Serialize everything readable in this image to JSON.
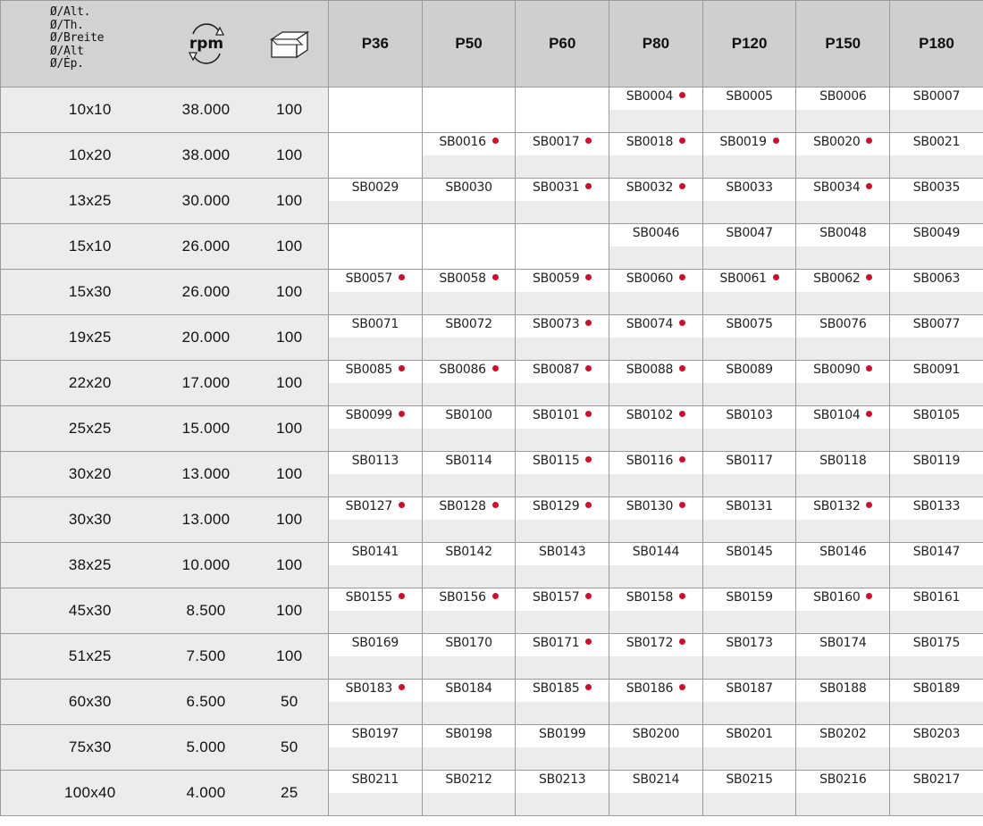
{
  "header": {
    "dimension_labels": [
      "Ø/Alt.",
      "Ø/Th.",
      "Ø/Breite",
      "Ø/Alt",
      "Ø/Ép."
    ],
    "rpm_icon_text": "rpm",
    "grits": [
      "P36",
      "P50",
      "P60",
      "P80",
      "P120",
      "P150",
      "P180"
    ]
  },
  "accent_color": "#c8102e",
  "rows": [
    {
      "size": "10x10",
      "rpm": "38.000",
      "qty": "100",
      "cells": [
        {
          "code": "",
          "dot": false
        },
        {
          "code": "",
          "dot": false
        },
        {
          "code": "",
          "dot": false
        },
        {
          "code": "SB0004",
          "dot": true
        },
        {
          "code": "SB0005",
          "dot": false
        },
        {
          "code": "SB0006",
          "dot": false
        },
        {
          "code": "SB0007",
          "dot": false
        }
      ]
    },
    {
      "size": "10x20",
      "rpm": "38.000",
      "qty": "100",
      "cells": [
        {
          "code": "",
          "dot": false
        },
        {
          "code": "SB0016",
          "dot": true
        },
        {
          "code": "SB0017",
          "dot": true
        },
        {
          "code": "SB0018",
          "dot": true
        },
        {
          "code": "SB0019",
          "dot": true
        },
        {
          "code": "SB0020",
          "dot": true
        },
        {
          "code": "SB0021",
          "dot": false
        }
      ]
    },
    {
      "size": "13x25",
      "rpm": "30.000",
      "qty": "100",
      "cells": [
        {
          "code": "SB0029",
          "dot": false
        },
        {
          "code": "SB0030",
          "dot": false
        },
        {
          "code": "SB0031",
          "dot": true
        },
        {
          "code": "SB0032",
          "dot": true
        },
        {
          "code": "SB0033",
          "dot": false
        },
        {
          "code": "SB0034",
          "dot": true
        },
        {
          "code": "SB0035",
          "dot": false
        }
      ]
    },
    {
      "size": "15x10",
      "rpm": "26.000",
      "qty": "100",
      "cells": [
        {
          "code": "",
          "dot": false
        },
        {
          "code": "",
          "dot": false
        },
        {
          "code": "",
          "dot": false
        },
        {
          "code": "SB0046",
          "dot": false
        },
        {
          "code": "SB0047",
          "dot": false
        },
        {
          "code": "SB0048",
          "dot": false
        },
        {
          "code": "SB0049",
          "dot": false
        }
      ]
    },
    {
      "size": "15x30",
      "rpm": "26.000",
      "qty": "100",
      "cells": [
        {
          "code": "SB0057",
          "dot": true
        },
        {
          "code": "SB0058",
          "dot": true
        },
        {
          "code": "SB0059",
          "dot": true
        },
        {
          "code": "SB0060",
          "dot": true
        },
        {
          "code": "SB0061",
          "dot": true
        },
        {
          "code": "SB0062",
          "dot": true
        },
        {
          "code": "SB0063",
          "dot": false
        }
      ]
    },
    {
      "size": "19x25",
      "rpm": "20.000",
      "qty": "100",
      "cells": [
        {
          "code": "SB0071",
          "dot": false
        },
        {
          "code": "SB0072",
          "dot": false
        },
        {
          "code": "SB0073",
          "dot": true
        },
        {
          "code": "SB0074",
          "dot": true
        },
        {
          "code": "SB0075",
          "dot": false
        },
        {
          "code": "SB0076",
          "dot": false
        },
        {
          "code": "SB0077",
          "dot": false
        }
      ]
    },
    {
      "size": "22x20",
      "rpm": "17.000",
      "qty": "100",
      "cells": [
        {
          "code": "SB0085",
          "dot": true
        },
        {
          "code": "SB0086",
          "dot": true
        },
        {
          "code": "SB0087",
          "dot": true
        },
        {
          "code": "SB0088",
          "dot": true
        },
        {
          "code": "SB0089",
          "dot": false
        },
        {
          "code": "SB0090",
          "dot": true
        },
        {
          "code": "SB0091",
          "dot": false
        }
      ]
    },
    {
      "size": "25x25",
      "rpm": "15.000",
      "qty": "100",
      "cells": [
        {
          "code": "SB0099",
          "dot": true
        },
        {
          "code": "SB0100",
          "dot": false
        },
        {
          "code": "SB0101",
          "dot": true
        },
        {
          "code": "SB0102",
          "dot": true
        },
        {
          "code": "SB0103",
          "dot": false
        },
        {
          "code": "SB0104",
          "dot": true
        },
        {
          "code": "SB0105",
          "dot": false
        }
      ]
    },
    {
      "size": "30x20",
      "rpm": "13.000",
      "qty": "100",
      "cells": [
        {
          "code": "SB0113",
          "dot": false
        },
        {
          "code": "SB0114",
          "dot": false
        },
        {
          "code": "SB0115",
          "dot": true
        },
        {
          "code": "SB0116",
          "dot": true
        },
        {
          "code": "SB0117",
          "dot": false
        },
        {
          "code": "SB0118",
          "dot": false
        },
        {
          "code": "SB0119",
          "dot": false
        }
      ]
    },
    {
      "size": "30x30",
      "rpm": "13.000",
      "qty": "100",
      "cells": [
        {
          "code": "SB0127",
          "dot": true
        },
        {
          "code": "SB0128",
          "dot": true
        },
        {
          "code": "SB0129",
          "dot": true
        },
        {
          "code": "SB0130",
          "dot": true
        },
        {
          "code": "SB0131",
          "dot": false
        },
        {
          "code": "SB0132",
          "dot": true
        },
        {
          "code": "SB0133",
          "dot": false
        }
      ]
    },
    {
      "size": "38x25",
      "rpm": "10.000",
      "qty": "100",
      "cells": [
        {
          "code": "SB0141",
          "dot": false
        },
        {
          "code": "SB0142",
          "dot": false
        },
        {
          "code": "SB0143",
          "dot": false
        },
        {
          "code": "SB0144",
          "dot": false
        },
        {
          "code": "SB0145",
          "dot": false
        },
        {
          "code": "SB0146",
          "dot": false
        },
        {
          "code": "SB0147",
          "dot": false
        }
      ]
    },
    {
      "size": "45x30",
      "rpm": "8.500",
      "qty": "100",
      "cells": [
        {
          "code": "SB0155",
          "dot": true
        },
        {
          "code": "SB0156",
          "dot": true
        },
        {
          "code": "SB0157",
          "dot": true
        },
        {
          "code": "SB0158",
          "dot": true
        },
        {
          "code": "SB0159",
          "dot": false
        },
        {
          "code": "SB0160",
          "dot": true
        },
        {
          "code": "SB0161",
          "dot": false
        }
      ]
    },
    {
      "size": "51x25",
      "rpm": "7.500",
      "qty": "100",
      "cells": [
        {
          "code": "SB0169",
          "dot": false
        },
        {
          "code": "SB0170",
          "dot": false
        },
        {
          "code": "SB0171",
          "dot": true
        },
        {
          "code": "SB0172",
          "dot": true
        },
        {
          "code": "SB0173",
          "dot": false
        },
        {
          "code": "SB0174",
          "dot": false
        },
        {
          "code": "SB0175",
          "dot": false
        }
      ]
    },
    {
      "size": "60x30",
      "rpm": "6.500",
      "qty": "50",
      "cells": [
        {
          "code": "SB0183",
          "dot": true
        },
        {
          "code": "SB0184",
          "dot": false
        },
        {
          "code": "SB0185",
          "dot": true
        },
        {
          "code": "SB0186",
          "dot": true
        },
        {
          "code": "SB0187",
          "dot": false
        },
        {
          "code": "SB0188",
          "dot": false
        },
        {
          "code": "SB0189",
          "dot": false
        }
      ]
    },
    {
      "size": "75x30",
      "rpm": "5.000",
      "qty": "50",
      "cells": [
        {
          "code": "SB0197",
          "dot": false
        },
        {
          "code": "SB0198",
          "dot": false
        },
        {
          "code": "SB0199",
          "dot": false
        },
        {
          "code": "SB0200",
          "dot": false
        },
        {
          "code": "SB0201",
          "dot": false
        },
        {
          "code": "SB0202",
          "dot": false
        },
        {
          "code": "SB0203",
          "dot": false
        }
      ]
    },
    {
      "size": "100x40",
      "rpm": "4.000",
      "qty": "25",
      "cells": [
        {
          "code": "SB0211",
          "dot": false
        },
        {
          "code": "SB0212",
          "dot": false
        },
        {
          "code": "SB0213",
          "dot": false
        },
        {
          "code": "SB0214",
          "dot": false
        },
        {
          "code": "SB0215",
          "dot": false
        },
        {
          "code": "SB0216",
          "dot": false
        },
        {
          "code": "SB0217",
          "dot": false
        }
      ]
    }
  ]
}
